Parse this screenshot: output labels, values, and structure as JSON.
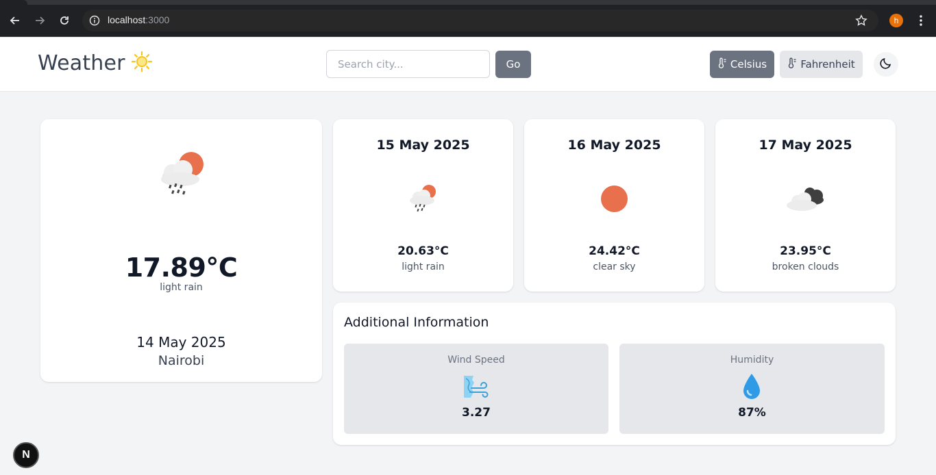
{
  "browser": {
    "url_host": "localhost",
    "url_port": ":3000",
    "profile_initial": "h",
    "icons": [
      "back-arrow-icon",
      "forward-arrow-icon",
      "reload-icon",
      "site-info-icon",
      "star-icon",
      "menu-dots-icon"
    ]
  },
  "header": {
    "title": "Weather",
    "title_icon": "sun-icon",
    "search_placeholder": "Search city...",
    "go_label": "Go",
    "celsius_label": "Celsius",
    "fahrenheit_label": "Fahrenheit",
    "active_unit": "Celsius",
    "theme_icon": "moon-icon"
  },
  "current": {
    "icon": "light-rain-icon",
    "temperature": "17.89°C",
    "description": "light rain",
    "date": "14 May 2025",
    "city": "Nairobi"
  },
  "forecast": [
    {
      "date": "15 May 2025",
      "icon": "light-rain-icon",
      "temperature": "20.63°C",
      "description": "light rain"
    },
    {
      "date": "16 May 2025",
      "icon": "clear-sky-icon",
      "temperature": "24.42°C",
      "description": "clear sky"
    },
    {
      "date": "17 May 2025",
      "icon": "broken-clouds-icon",
      "temperature": "23.95°C",
      "description": "broken clouds"
    }
  ],
  "additional": {
    "title": "Additional Information",
    "wind": {
      "label": "Wind Speed",
      "value": "3.27",
      "icon": "wind-icon"
    },
    "humidity": {
      "label": "Humidity",
      "value": "87%",
      "icon": "droplet-icon"
    }
  },
  "dev_badge": "N",
  "colors": {
    "accent_gray": "#6b7280",
    "sun_orange": "#e8704c",
    "sun_yellow": "#f5c518",
    "page_bg": "#f3f4f6"
  }
}
